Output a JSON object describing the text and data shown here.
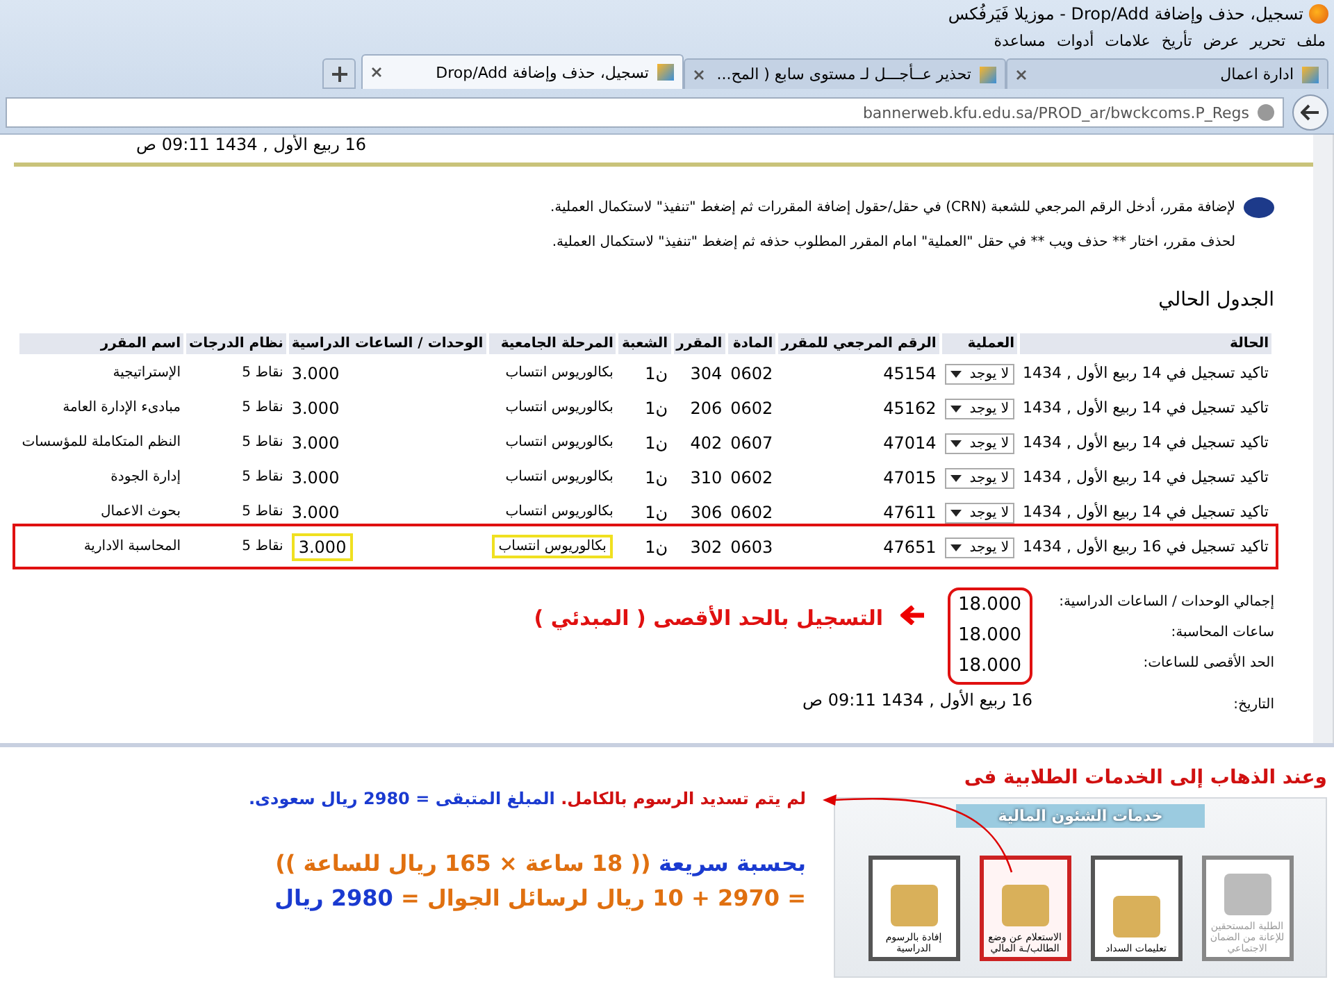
{
  "window": {
    "title": "تسجيل، حذف وإضافة Drop/Add - موزيلا فَيَرفُكس"
  },
  "menu": [
    "ملف",
    "تحرير",
    "عرض",
    "تأريخ",
    "علامات",
    "أدوات",
    "مساعدة"
  ],
  "tabs": [
    {
      "label": "ادارة اعمال",
      "selected": false
    },
    {
      "label": "تحذير عــأجـــل لـ مستوى سابع ( المح...",
      "selected": false
    },
    {
      "label": "تسجيل، حذف وإضافة Drop/Add",
      "selected": true
    }
  ],
  "address": "bannerweb.kfu.edu.sa/PROD_ar/bwckcoms.P_Regs",
  "header_date": "16 ربيع الأول , 1434 09:11 ص",
  "instructions": [
    "لإضافة مقرر، أدخل الرقم المرجعي للشعبة (CRN) في حقل/حقول إضافة المقررات ثم إضغط \"تنفيذ\" لاستكمال العملية.",
    "لحذف مقرر، اختار ** حذف ويب ** في حقل \"العملية\" امام المقرر المطلوب حذفه ثم إضغط \"تنفيذ\" لاستكمال العملية."
  ],
  "section_title": "الجدول الحالي",
  "table": {
    "columns": [
      "الحالة",
      "العملية",
      "الرقم المرجعي للمقرر",
      "المادة",
      "المقرر",
      "الشعبة",
      "المرحلة الجامعية",
      "الوحدات / الساعات الدراسية",
      "نظام الدرجات",
      "اسم المقرر"
    ],
    "rows": [
      {
        "status": "تاكيد تسجيل في 14 ربيع الأول , 1434",
        "action": "لا يوجد",
        "crn": "45154",
        "subject": "0602",
        "course": "304",
        "section": "ن1",
        "level": "بكالوريوس انتساب",
        "units": "3.000",
        "grading": "نقاط 5",
        "title": "الإستراتيجية",
        "highlighted": false
      },
      {
        "status": "تاكيد تسجيل في 14 ربيع الأول , 1434",
        "action": "لا يوجد",
        "crn": "45162",
        "subject": "0602",
        "course": "206",
        "section": "ن1",
        "level": "بكالوريوس انتساب",
        "units": "3.000",
        "grading": "نقاط 5",
        "title": "مبادىء الإدارة العامة",
        "highlighted": false
      },
      {
        "status": "تاكيد تسجيل في 14 ربيع الأول , 1434",
        "action": "لا يوجد",
        "crn": "47014",
        "subject": "0607",
        "course": "402",
        "section": "ن1",
        "level": "بكالوريوس انتساب",
        "units": "3.000",
        "grading": "نقاط 5",
        "title": "النظم المتكاملة للمؤسسات",
        "highlighted": false
      },
      {
        "status": "تاكيد تسجيل في 14 ربيع الأول , 1434",
        "action": "لا يوجد",
        "crn": "47015",
        "subject": "0602",
        "course": "310",
        "section": "ن1",
        "level": "بكالوريوس انتساب",
        "units": "3.000",
        "grading": "نقاط 5",
        "title": "إدارة الجودة",
        "highlighted": false
      },
      {
        "status": "تاكيد تسجيل في 14 ربيع الأول , 1434",
        "action": "لا يوجد",
        "crn": "47611",
        "subject": "0602",
        "course": "306",
        "section": "ن1",
        "level": "بكالوريوس انتساب",
        "units": "3.000",
        "grading": "نقاط 5",
        "title": "بحوث الاعمال",
        "highlighted": false
      },
      {
        "status": "تاكيد تسجيل في 16 ربيع الأول , 1434",
        "action": "لا يوجد",
        "crn": "47651",
        "subject": "0603",
        "course": "302",
        "section": "ن1",
        "level": "بكالوريوس انتساب",
        "units": "3.000",
        "grading": "نقاط 5",
        "title": "المحاسبة الادارية",
        "highlighted": true
      }
    ]
  },
  "totals": [
    {
      "label": "إجمالي الوحدات / الساعات الدراسية:",
      "value": "18.000"
    },
    {
      "label": "ساعات المحاسبة:",
      "value": "18.000"
    },
    {
      "label": "الحد الأقصى للساعات:",
      "value": "18.000"
    }
  ],
  "date_row": {
    "label": "التاريخ:",
    "value": "16 ربيع الأول , 1434 09:11 ص"
  },
  "annotation": "التسجيل بالحد الأقصى ( المبدئي )",
  "services_heading": "وعند الذهاب إلى الخدمات الطلابية فى",
  "services": {
    "title": "خدمات الشئون المالية",
    "tiles": [
      {
        "label": "الطلبة المستحقين للإعانة من الضمان الاجتماعي",
        "disabled": true,
        "selected": false
      },
      {
        "label": "تعليمات السداد",
        "disabled": false,
        "selected": false
      },
      {
        "label": "الاستعلام عن وضع الطالب/ـة المالي",
        "disabled": false,
        "selected": true
      },
      {
        "label": "إفادة بالرسوم الدراسية",
        "disabled": false,
        "selected": false
      }
    ]
  },
  "note": [
    {
      "kind": "warning",
      "text": "لم يتم تسديد الرسوم بالكامل."
    },
    {
      "kind": "amount",
      "text": "المبلغ المتبقى = 2980 ريال سعودى."
    }
  ],
  "calculation": [
    [
      {
        "kind": "label",
        "text": "بحسبة سريعة"
      },
      {
        "kind": "figure",
        "text": "(( 18 ساعة × 165 ريال للساعة ))"
      }
    ],
    [
      {
        "kind": "figure",
        "text": "= 2970 + 10 ريال لرسائل الجوال ="
      },
      {
        "kind": "label",
        "text": "2980 ريال"
      }
    ]
  ]
}
